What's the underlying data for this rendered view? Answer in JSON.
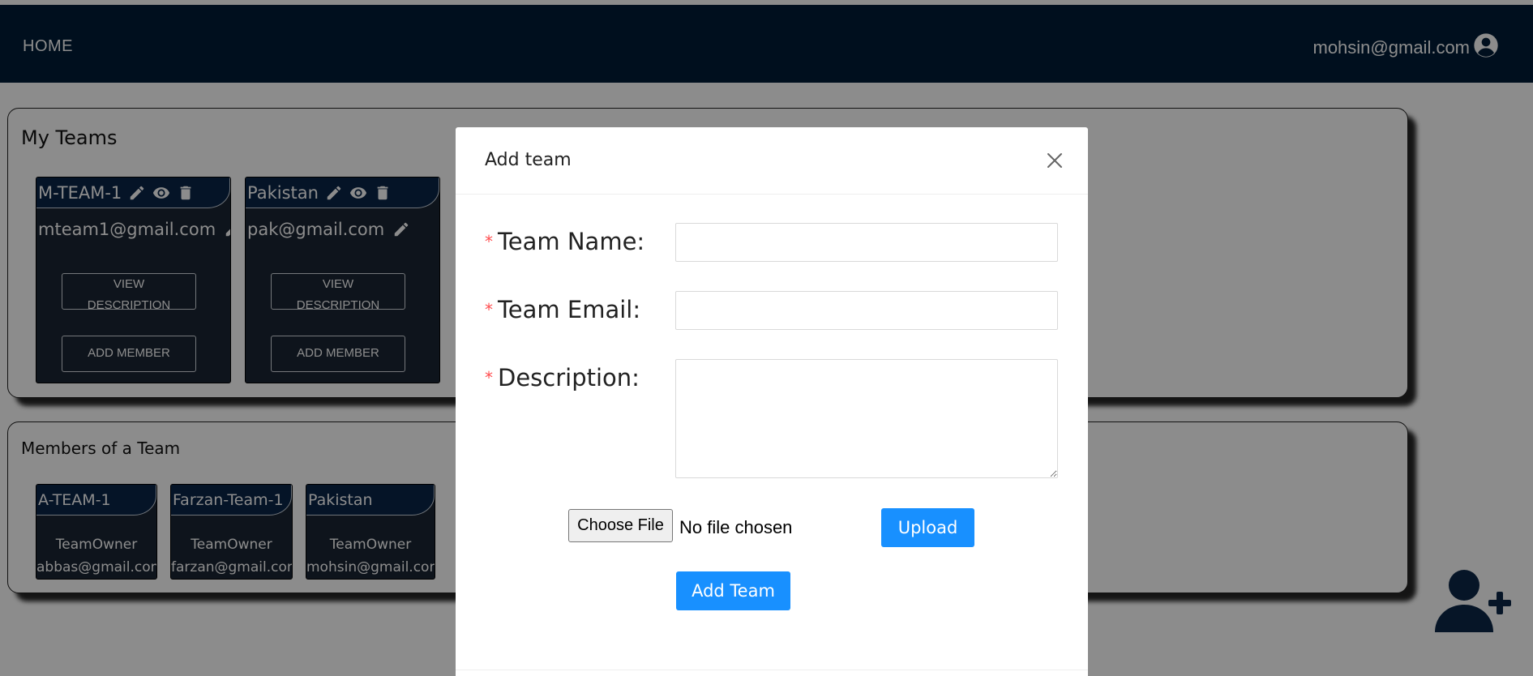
{
  "navbar": {
    "home_label": "HOME",
    "user_email": "mohsin@gmail.com"
  },
  "my_teams": {
    "title": "My Teams",
    "teams": [
      {
        "name": "M-TEAM-1",
        "email": "mteam1@gmail.com",
        "view_description_label": "VIEW DESCRIPTION",
        "add_member_label": "ADD MEMBER"
      },
      {
        "name": "Pakistan",
        "email": "pak@gmail.com",
        "view_description_label": "VIEW DESCRIPTION",
        "add_member_label": "ADD MEMBER"
      }
    ]
  },
  "members_of_team": {
    "title": "Members of a Team",
    "teams": [
      {
        "name": "A-TEAM-1",
        "role": "TeamOwner",
        "email": "abbas@gmail.com"
      },
      {
        "name": "Farzan-Team-1",
        "role": "TeamOwner",
        "email": "farzan@gmail.com"
      },
      {
        "name": "Pakistan",
        "role": "TeamOwner",
        "email": "mohsin@gmail.com"
      }
    ]
  },
  "modal": {
    "title": "Add team",
    "team_name_label": "Team Name:",
    "team_email_label": "Team Email:",
    "description_label": "Description:",
    "required_mark": "*",
    "team_name_value": "",
    "team_email_value": "",
    "description_value": "",
    "choose_file_label": "Choose File",
    "file_status": "No file chosen",
    "upload_label": "Upload",
    "add_team_label": "Add Team"
  },
  "colors": {
    "navbar": "#001d38",
    "card": "#1b2634",
    "primary_button": "#1890ff",
    "required": "#ff4d4f"
  },
  "icons": [
    "user-circle-icon",
    "pencil-icon",
    "eye-icon",
    "trash-icon",
    "close-icon",
    "add-user-icon"
  ]
}
